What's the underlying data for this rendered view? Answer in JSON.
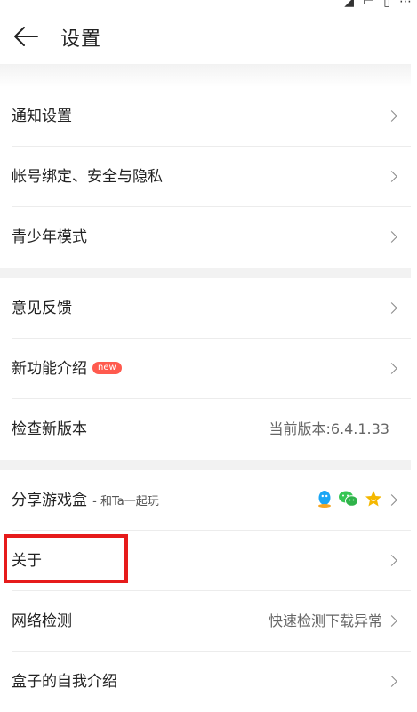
{
  "header": {
    "title": "设置"
  },
  "sections": [
    {
      "rows": [
        {
          "label": "通知设置"
        },
        {
          "label": "帐号绑定、安全与隐私"
        },
        {
          "label": "青少年模式"
        }
      ]
    },
    {
      "rows": [
        {
          "label": "意见反馈"
        },
        {
          "label": "新功能介绍",
          "badge": "new"
        },
        {
          "label": "检查新版本",
          "value": "当前版本:6.4.1.33"
        }
      ]
    },
    {
      "rows": [
        {
          "label": "分享游戏盒",
          "sub": " - 和Ta一起玩",
          "icons": [
            "qq-icon",
            "wechat-icon",
            "star-icon"
          ]
        },
        {
          "label": "关于"
        },
        {
          "label": "网络检测",
          "value": "快速检测下载异常"
        },
        {
          "label": "盒子的自我介绍"
        }
      ]
    }
  ],
  "colors": {
    "accent": "#e61b1b",
    "badge": "#ff5a4e",
    "qq": "#1aa6f5",
    "wechat": "#36c653",
    "star": "#f5b800"
  }
}
